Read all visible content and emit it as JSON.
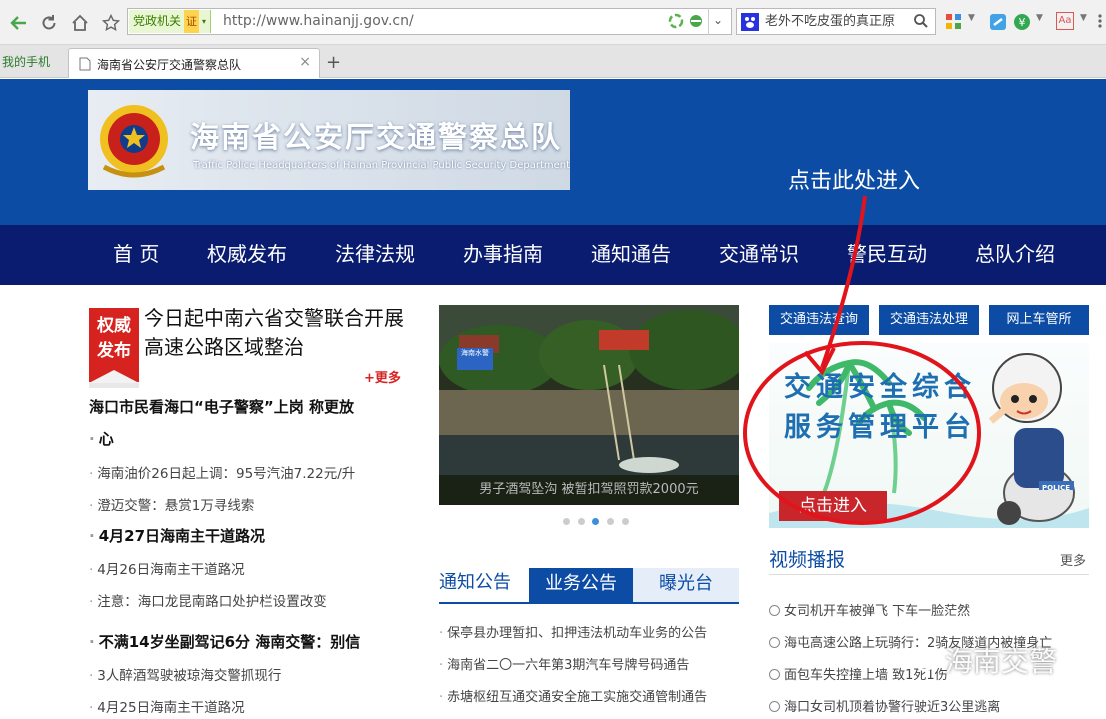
{
  "browser": {
    "cert_label": "党政机关",
    "cert_seal": "证",
    "url": "http://www.hainanjj.gov.cn/",
    "search_text": "老外不吃皮蛋的真正原",
    "mobile_link": "我的手机",
    "tab_title": "海南省公安厅交通警察总队",
    "new_tab": "+",
    "tab_close": "×",
    "ext_label": "Aa"
  },
  "header": {
    "site_title": "海南省公安厅交通警察总队",
    "site_subtitle": "Traffic Police Headquarters of Hainan Provincial Public Security Department",
    "annotation": "点击此处进入"
  },
  "nav": [
    "首 页",
    "权威发布",
    "法律法规",
    "办事指南",
    "通知通告",
    "交通常识",
    "警民互动",
    "总队介绍"
  ],
  "left": {
    "badge_line1": "权威",
    "badge_line2": "发布",
    "headline": "今日起中南六省交警联合开展高速公路区域整治",
    "more": "+更多",
    "items": [
      {
        "text": "海口市民看海口“电子警察”上岗 称更放",
        "bold": true
      },
      {
        "text": "心",
        "bold": true
      },
      {
        "text": "海南油价26日起上调：95号汽油7.22元/升",
        "bold": false
      },
      {
        "text": "澄迈交警：悬赏1万寻线索",
        "bold": false
      },
      {
        "text": "4月27日海南主干道路况",
        "bold": true
      },
      {
        "text": "4月26日海南主干道路况",
        "bold": false
      },
      {
        "text": "注意：海口龙昆南路口处护栏设置改变",
        "bold": false
      },
      {
        "text": "不满14岁坐副驾记6分 海南交警：别信",
        "bold": true
      },
      {
        "text": "3人醉酒驾驶被琼海交警抓现行",
        "bold": false
      },
      {
        "text": "4月25日海南主干道路况",
        "bold": false
      }
    ]
  },
  "center": {
    "slide_caption": "男子酒驾坠沟 被暂扣驾照罚款2000元",
    "slide_sign": "海南水警",
    "tabs": [
      "通知公告",
      "业务公告",
      "曝光台"
    ],
    "items": [
      "保亭县办理暂扣、扣押违法机动车业务的公告",
      "海南省二〇一六年第3期汽车号牌号码通告",
      "赤塘枢纽互通交通安全施工实施交通管制通告"
    ]
  },
  "right": {
    "buttons": [
      "交通违法查询",
      "交通违法处理",
      "网上车管所"
    ],
    "platform_line1": "交通安全综合",
    "platform_line2": "服务管理平台",
    "platform_enter": "点击进入",
    "platform_badge": "POLICE",
    "video_title": "视频播报",
    "video_more": "更多",
    "videos": [
      "女司机开车被弹飞 下车一脸茫然",
      "海屯高速公路上玩骑行：2骑友隧道内被撞身亡",
      "面包车失控撞上墙 致1死1伤",
      "海口女司机顶着协警行驶近3公里逃离"
    ]
  },
  "watermark": "海南交警",
  "colors": {
    "brand_blue": "#0c4ca5",
    "nav_navy": "#0a1c70",
    "alert_red": "#d72320",
    "annotation_red": "#e1141b"
  }
}
